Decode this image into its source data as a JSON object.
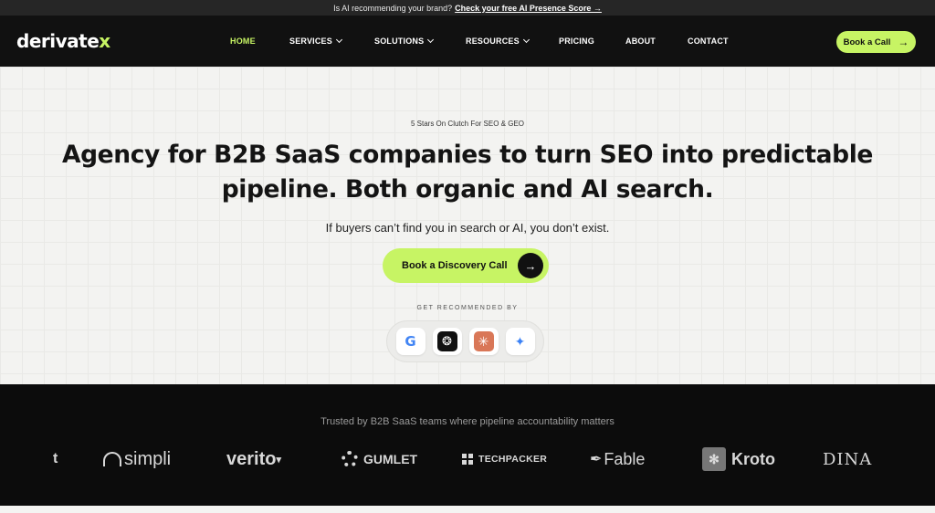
{
  "announcement": {
    "text": "Is AI recommending your brand?",
    "link": "Check your free AI Presence Score →"
  },
  "nav": {
    "logo_main": "derivate",
    "logo_accent": "x",
    "items": [
      {
        "label": "HOME",
        "active": true,
        "dropdown": false
      },
      {
        "label": "SERVICES",
        "active": false,
        "dropdown": true
      },
      {
        "label": "SOLUTIONS",
        "active": false,
        "dropdown": true
      },
      {
        "label": "RESOURCES",
        "active": false,
        "dropdown": true
      },
      {
        "label": "PRICING",
        "active": false,
        "dropdown": false
      },
      {
        "label": "ABOUT",
        "active": false,
        "dropdown": false
      },
      {
        "label": "CONTACT",
        "active": false,
        "dropdown": false
      }
    ],
    "cta_label": "Book a Call",
    "cta_icon": "arrow-right-icon"
  },
  "hero": {
    "eyebrow": "5 Stars On Clutch For SEO & GEO",
    "headline_line1": "Agency for B2B SaaS companies to turn SEO into predictable",
    "headline_line2": "pipeline. Both organic and AI search.",
    "subheadline": "If buyers can’t find you in search or AI, you don’t exist.",
    "cta_label": "Book a Discovery Call",
    "recommended_label": "GET RECOMMENDED BY",
    "recommenders": [
      "google-icon",
      "chatgpt-icon",
      "claude-icon",
      "gemini-icon"
    ]
  },
  "trust": {
    "title": "Trusted by B2B SaaS teams where pipeline accountability matters",
    "logos": [
      "t",
      "simpli",
      "verito",
      "GUMLET",
      "TECHPACKER",
      "Fable",
      "Kroto",
      "DINA"
    ]
  },
  "colors": {
    "accent": "#c7f464",
    "nav_bg": "#111111",
    "hero_bg": "#f3f3f1",
    "trust_bg": "#0c0c0c"
  }
}
